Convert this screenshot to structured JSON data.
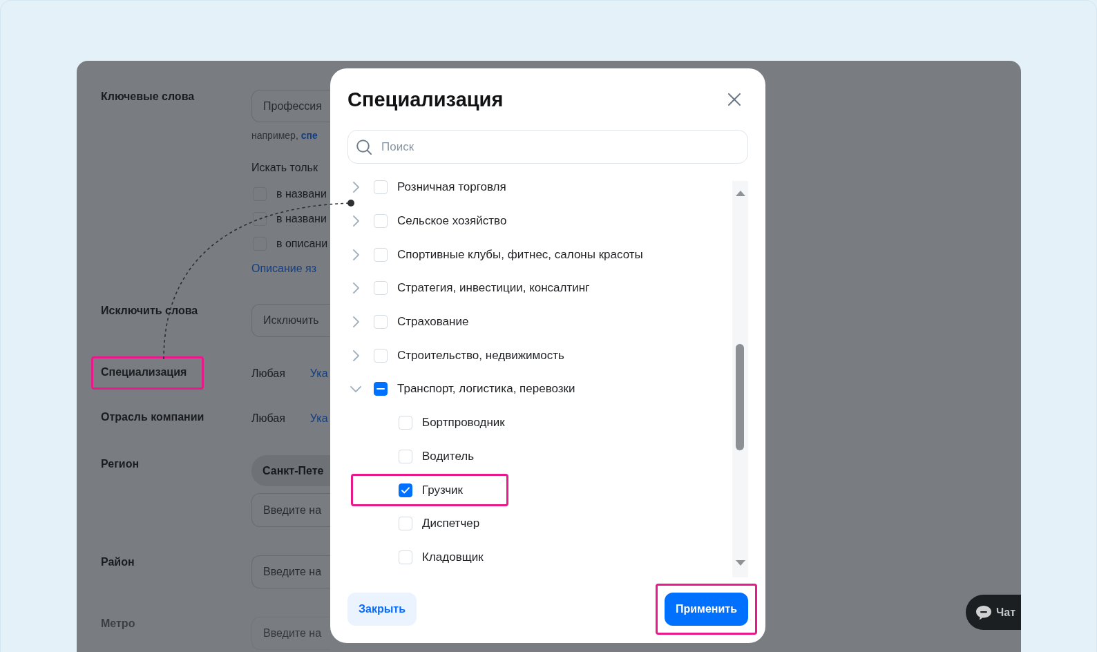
{
  "form": {
    "rows": [
      {
        "kind": "keywords",
        "label": "Ключевые слова",
        "disabled": false,
        "highlighted": false,
        "placeholder": "Профессия",
        "hint": "например,",
        "hint_link": "спе",
        "scope_title": "Искать тольк",
        "options": [
          {
            "label": "в названи",
            "checked": false
          },
          {
            "label": "в названи",
            "checked": false
          },
          {
            "label": "в описани",
            "checked": false
          }
        ],
        "link": "Описание яз"
      },
      {
        "kind": "input",
        "label": "Исключить слова",
        "disabled": false,
        "highlighted": false,
        "placeholder": "Исключить"
      },
      {
        "kind": "choice",
        "label": "Специализация",
        "disabled": false,
        "highlighted": true,
        "value": "Любая",
        "link": "Ука"
      },
      {
        "kind": "choice",
        "label": "Отрасль компании",
        "disabled": false,
        "highlighted": false,
        "value": "Любая",
        "link": "Ука"
      },
      {
        "kind": "region",
        "label": "Регион",
        "disabled": false,
        "highlighted": false,
        "chip": "Санкт-Пете",
        "placeholder": "Введите на"
      },
      {
        "kind": "input",
        "label": "Район",
        "disabled": false,
        "highlighted": false,
        "placeholder": "Введите на"
      },
      {
        "kind": "input",
        "label": "Метро",
        "disabled": true,
        "highlighted": false,
        "placeholder": "Введите на"
      }
    ]
  },
  "modal": {
    "title": "Специализация",
    "search": {
      "placeholder": "Поиск"
    },
    "tree": {
      "items": [
        {
          "label": "Розничная торговля",
          "expanded": false,
          "checked": false,
          "indeterminate": false,
          "highlighted": false
        },
        {
          "label": "Сельское хозяйство",
          "expanded": false,
          "checked": false,
          "indeterminate": false,
          "highlighted": false
        },
        {
          "label": "Спортивные клубы, фитнес, салоны красоты",
          "expanded": false,
          "checked": false,
          "indeterminate": false,
          "highlighted": false
        },
        {
          "label": "Стратегия, инвестиции, консалтинг",
          "expanded": false,
          "checked": false,
          "indeterminate": false,
          "highlighted": false
        },
        {
          "label": "Страхование",
          "expanded": false,
          "checked": false,
          "indeterminate": false,
          "highlighted": false
        },
        {
          "label": "Строительство, недвижимость",
          "expanded": false,
          "checked": false,
          "indeterminate": false,
          "highlighted": false
        },
        {
          "label": "Транспорт, логистика, перевозки",
          "expanded": true,
          "checked": false,
          "indeterminate": true,
          "highlighted": false,
          "children": [
            {
              "label": "Бортпроводник",
              "checked": false,
              "highlighted": false
            },
            {
              "label": "Водитель",
              "checked": false,
              "highlighted": false
            },
            {
              "label": "Грузчик",
              "checked": true,
              "highlighted": true
            },
            {
              "label": "Диспетчер",
              "checked": false,
              "highlighted": false
            },
            {
              "label": "Кладовщик",
              "checked": false,
              "highlighted": false
            }
          ]
        }
      ]
    },
    "buttons": [
      {
        "kind": "secondary",
        "label": "Закрыть",
        "highlighted": false
      },
      {
        "kind": "primary",
        "label": "Применить",
        "highlighted": true
      }
    ]
  },
  "chat_button": {
    "label": "Чат"
  }
}
